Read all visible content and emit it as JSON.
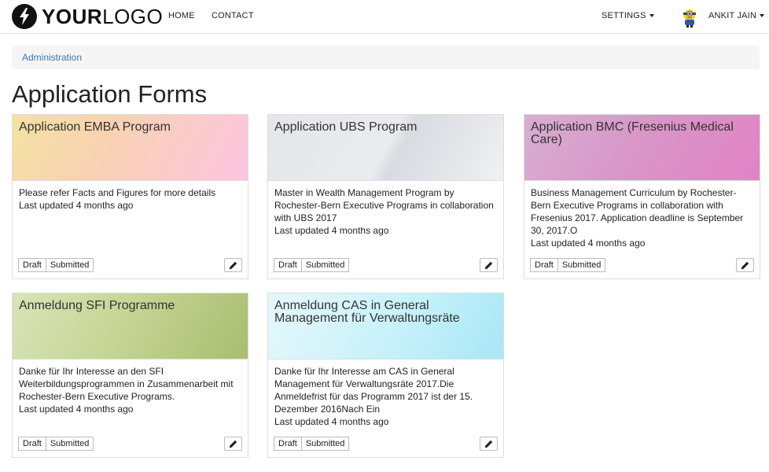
{
  "header": {
    "logo_bold": "YOUR",
    "logo_light": "LOGO",
    "nav": [
      "HOME",
      "CONTACT"
    ],
    "settings_label": "SETTINGS",
    "user_name": "ANKIT JAIN"
  },
  "breadcrumb": {
    "label": "Administration"
  },
  "page": {
    "title": "Application Forms"
  },
  "cards": [
    {
      "title": "Application EMBA Program",
      "description": "Please refer Facts and Figures for more details",
      "updated": "Last updated 4 months ago",
      "draft_label": "Draft",
      "submitted_label": "Submitted"
    },
    {
      "title": "Application UBS Program",
      "description": "Master in Wealth Management Program by Rochester-Bern Executive Programs in collaboration with UBS 2017",
      "updated": "Last updated 4 months ago",
      "draft_label": "Draft",
      "submitted_label": "Submitted"
    },
    {
      "title": "Application BMC (Fresenius Medical Care)",
      "description": "Business Management Curriculum by Rochester-Bern Executive Programs in collaboration with Fresenius 2017. Application deadline is September 30, 2017.O",
      "updated": "Last updated 4 months ago",
      "draft_label": "Draft",
      "submitted_label": "Submitted"
    },
    {
      "title": "Anmeldung SFI Programme",
      "description": "Danke für Ihr Interesse an den SFI Weiterbildungsprogrammen in Zusammenarbeit mit Rochester-Bern Executive Programs.",
      "updated": "Last updated 4 months ago",
      "draft_label": "Draft",
      "submitted_label": "Submitted"
    },
    {
      "title": "Anmeldung CAS in General Management für Verwaltungsräte",
      "description": "Danke für Ihr Interesse am CAS in General Management für Verwaltungsräte 2017.Die Anmeldefrist für das Programm 2017 ist der 15. Dezember 2016Nach Ein",
      "updated": "Last updated 4 months ago",
      "draft_label": "Draft",
      "submitted_label": "Submitted"
    }
  ],
  "icons": {
    "logo": "lightning-bolt-icon",
    "settings_caret": "caret-down-icon",
    "user_caret": "caret-down-icon",
    "edit": "pencil-icon"
  },
  "colors": {
    "link": "#337ab7",
    "card1_header": "#f8d2b2",
    "card2_header": "#e9ebee",
    "card3_header": "#d995c6",
    "card4_header": "#c7d596",
    "card5_header": "#c7f1fa"
  }
}
